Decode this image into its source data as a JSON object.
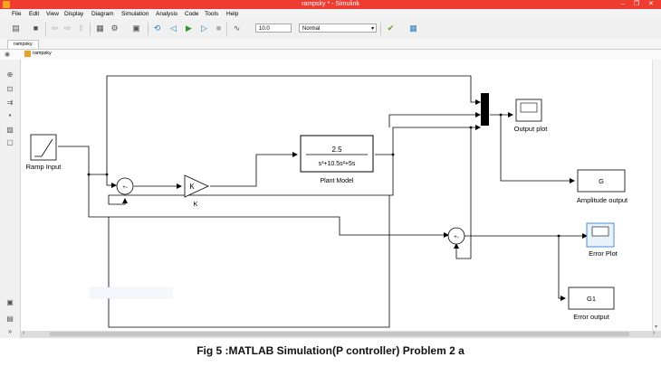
{
  "window": {
    "title": "rampsky * - Simulink"
  },
  "menu": [
    "File",
    "Edit",
    "View",
    "Display",
    "Diagram",
    "Simulation",
    "Analysis",
    "Code",
    "Tools",
    "Help"
  ],
  "toolbar": {
    "stop_time": "10.0",
    "sim_mode": "Normal"
  },
  "tab": {
    "label": "rampsky"
  },
  "address": {
    "path": "rampsky"
  },
  "blocks": {
    "ramp": {
      "label": "Ramp Input"
    },
    "gain": {
      "symbol": "K",
      "label": "K"
    },
    "plant": {
      "numerator": "2.5",
      "denominator": "s³+10.5s²+5s",
      "label": "Plant Model"
    },
    "sum1": {
      "signs": "+-"
    },
    "sum2": {
      "signs": "+-"
    },
    "scope1": {
      "label": "Output plot"
    },
    "scope2": {
      "label": "Error Plot"
    },
    "display1": {
      "value": "G",
      "label": "Amplitude output"
    },
    "display2": {
      "value": "G1",
      "label": "Error output"
    }
  },
  "caption": "Fig 5 :MATLAB Simulation(P controller)  Problem 2 a"
}
